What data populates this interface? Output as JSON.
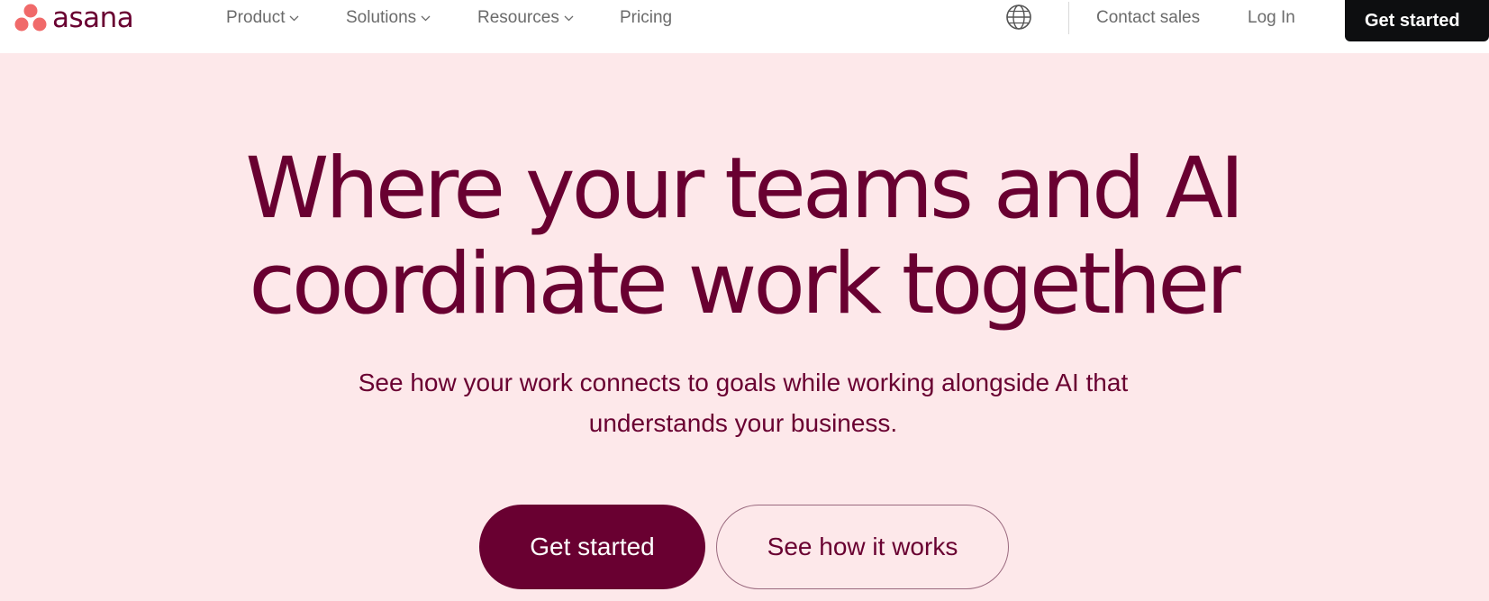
{
  "brand": {
    "name": "asana",
    "dot_color": "#f06a6a",
    "text_color": "#690031"
  },
  "nav": {
    "items": [
      {
        "label": "Product",
        "icon": "chevron-down-icon"
      },
      {
        "label": "Solutions",
        "icon": "chevron-down-icon"
      },
      {
        "label": "Resources",
        "icon": "chevron-down-icon"
      },
      {
        "label": "Pricing"
      }
    ],
    "language_icon": "globe-icon",
    "contact_sales": "Contact sales",
    "log_in": "Log In",
    "cta": "Get started"
  },
  "hero": {
    "headline": "Where your teams and AI coordinate work together",
    "subhead": "See how your work connects to goals while working alongside AI that understands your business.",
    "primary_cta": "Get started",
    "secondary_cta": "See how it works",
    "background_color": "#fde8ea",
    "accent_color": "#690031"
  }
}
